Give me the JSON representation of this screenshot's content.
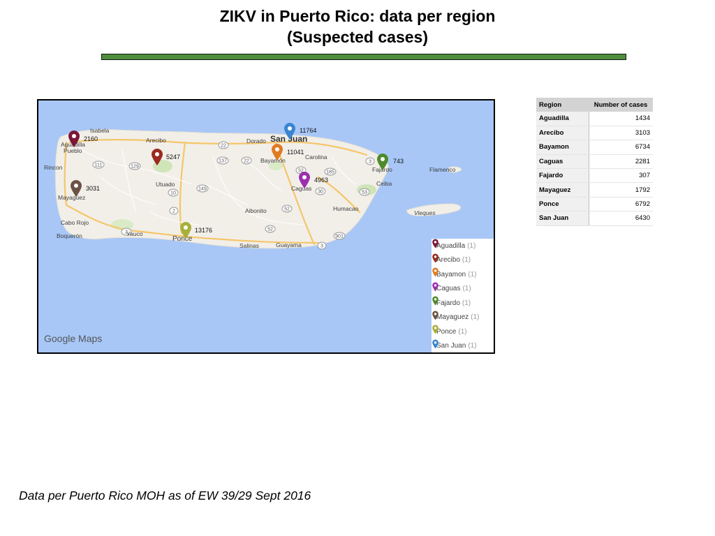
{
  "title": {
    "line1": "ZIKV in Puerto Rico: data per region",
    "line2": "(Suspected cases)"
  },
  "map": {
    "watermark": "Google Maps",
    "place_labels": [
      {
        "id": "isabela",
        "text": "Isabela"
      },
      {
        "id": "aguadilla",
        "text": "Aguadilla"
      },
      {
        "id": "pueblo",
        "text": "Pueblo"
      },
      {
        "id": "arecibo",
        "text": "Arecibo"
      },
      {
        "id": "dorado",
        "text": "Dorado"
      },
      {
        "id": "sanjuan",
        "text": "San Juan"
      },
      {
        "id": "carolina",
        "text": "Carolina"
      },
      {
        "id": "bayamon",
        "text": "Bayamón"
      },
      {
        "id": "rincon",
        "text": "Rincon"
      },
      {
        "id": "utuado",
        "text": "Utuado"
      },
      {
        "id": "caguas",
        "text": "Caguas"
      },
      {
        "id": "fajardo",
        "text": "Fajardo"
      },
      {
        "id": "flamenco",
        "text": "Flamenco"
      },
      {
        "id": "ceiba",
        "text": "Ceiba"
      },
      {
        "id": "mayaguez",
        "text": "Mayagüez"
      },
      {
        "id": "aibonito",
        "text": "Aibonito"
      },
      {
        "id": "humacao",
        "text": "Humacao"
      },
      {
        "id": "vieques",
        "text": "Vieques"
      },
      {
        "id": "caborojo",
        "text": "Cabo Rojo"
      },
      {
        "id": "yauco",
        "text": "Yauco"
      },
      {
        "id": "boqueron",
        "text": "Boquerón"
      },
      {
        "id": "ponce",
        "text": "Ponce"
      },
      {
        "id": "salinas",
        "text": "Salinas"
      },
      {
        "id": "guayama",
        "text": "Guayama"
      }
    ],
    "route_labels": [
      "22",
      "129",
      "111",
      "2",
      "137",
      "22",
      "52",
      "3",
      "185",
      "149",
      "10",
      "52",
      "53",
      "2",
      "52",
      "3",
      "901",
      "30"
    ],
    "markers": [
      {
        "region": "Aguadilla",
        "count": "2160",
        "color": "#7b1738"
      },
      {
        "region": "Arecibo",
        "count": "5247",
        "color": "#9a2b1e"
      },
      {
        "region": "Bayamon",
        "count": "11041",
        "color": "#e07b25"
      },
      {
        "region": "San Juan",
        "count": "11764",
        "color": "#3a85cf"
      },
      {
        "region": "Fajardo",
        "count": "743",
        "color": "#4f8a2a"
      },
      {
        "region": "Caguas",
        "count": "4963",
        "color": "#9b2fae"
      },
      {
        "region": "Mayaguez",
        "count": "3031",
        "color": "#6b5244"
      },
      {
        "region": "Ponce",
        "count": "13176",
        "color": "#a7b03a"
      }
    ],
    "legend": [
      {
        "label": "Aguadilla",
        "count": "(1)",
        "color": "#7b1738"
      },
      {
        "label": "Arecibo",
        "count": "(1)",
        "color": "#9a2b1e"
      },
      {
        "label": "Bayamon",
        "count": "(1)",
        "color": "#e07b25"
      },
      {
        "label": "Caguas",
        "count": "(1)",
        "color": "#9b2fae"
      },
      {
        "label": "Fajardo",
        "count": "(1)",
        "color": "#4f8a2a"
      },
      {
        "label": "Mayaguez",
        "count": "(1)",
        "color": "#6b5244"
      },
      {
        "label": "Ponce",
        "count": "(1)",
        "color": "#a7b03a"
      },
      {
        "label": "San Juan",
        "count": "(1)",
        "color": "#3a85cf"
      }
    ]
  },
  "table": {
    "headers": [
      "Region",
      "Number of cases"
    ],
    "rows": [
      [
        "Aguadilla",
        "1434"
      ],
      [
        "Arecibo",
        "3103"
      ],
      [
        "Bayamon",
        "6734"
      ],
      [
        "Caguas",
        "2281"
      ],
      [
        "Fajardo",
        "307"
      ],
      [
        "Mayaguez",
        "1792"
      ],
      [
        "Ponce",
        "6792"
      ],
      [
        "San Juan",
        "6430"
      ]
    ]
  },
  "footnote": "Data per Puerto Rico MOH as of EW 39/29 Sept 2016",
  "colors": {
    "title_bar": "#4e8f3e",
    "water": "#a8c7f7",
    "land": "#f2efe9"
  }
}
